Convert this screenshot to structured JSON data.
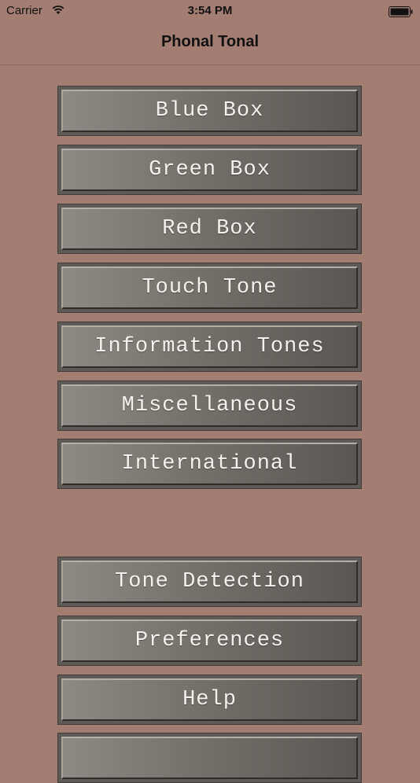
{
  "status_bar": {
    "carrier": "Carrier",
    "time": "3:54 PM"
  },
  "nav": {
    "title": "Phonal Tonal"
  },
  "menu": {
    "items": [
      {
        "label": "Blue Box"
      },
      {
        "label": "Green Box"
      },
      {
        "label": "Red Box"
      },
      {
        "label": "Touch Tone"
      },
      {
        "label": "Information Tones"
      },
      {
        "label": "Miscellaneous"
      },
      {
        "label": "International"
      },
      {
        "label": "Tone Detection"
      },
      {
        "label": "Preferences"
      },
      {
        "label": "Help"
      }
    ]
  },
  "colors": {
    "background": "#a37d72",
    "button_face": "#74716b",
    "button_text": "#f4f2ec"
  },
  "icons": [
    "wifi-icon",
    "battery-icon"
  ]
}
